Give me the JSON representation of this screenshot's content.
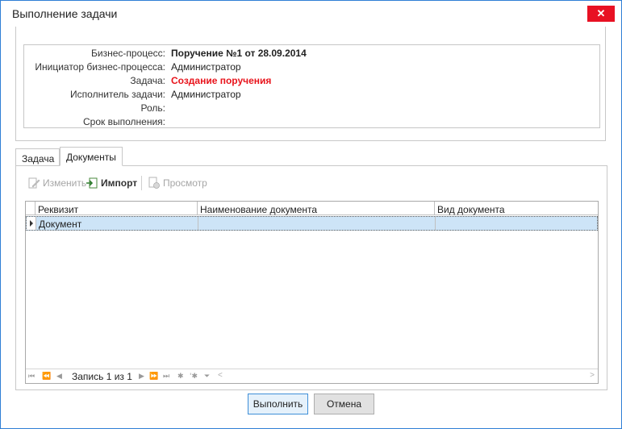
{
  "window": {
    "title": "Выполнение задачи",
    "close_symbol": "✕"
  },
  "info": {
    "rows": [
      {
        "label": "Бизнес-процесс:",
        "value": "Поручение №1 от 28.09.2014"
      },
      {
        "label": "Инициатор бизнес-процесса:",
        "value": "Администратор"
      },
      {
        "label": "Задача:",
        "value": "Создание поручения"
      },
      {
        "label": "Исполнитель задачи:",
        "value": "Администратор"
      },
      {
        "label": "Роль:",
        "value": ""
      },
      {
        "label": "Срок выполнения:",
        "value": ""
      }
    ]
  },
  "tabs": [
    {
      "label": "Задача"
    },
    {
      "label": "Документы"
    }
  ],
  "toolbar": {
    "edit_label": "Изменить",
    "import_label": "Импорт",
    "view_label": "Просмотр"
  },
  "grid": {
    "columns": [
      "Реквизит",
      "Наименование документа",
      "Вид документа"
    ],
    "rows": [
      [
        "Документ",
        "",
        ""
      ]
    ]
  },
  "navigator": {
    "record_text": "Запись 1 из 1"
  },
  "buttons": {
    "execute": "Выполнить",
    "cancel": "Отмена"
  },
  "colors": {
    "accent": "#2f7fd6",
    "close": "#e81123",
    "highlight": "#e8131b",
    "selection": "#cde4f7"
  }
}
